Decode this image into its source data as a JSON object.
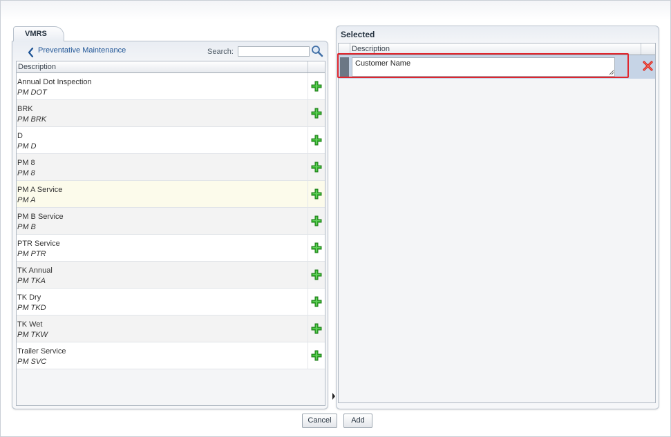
{
  "tab": {
    "label": "VMRS"
  },
  "left": {
    "back_label": "Preventative Maintenance",
    "search_label": "Search:",
    "search_value": "",
    "column_header": "Description",
    "rows": [
      {
        "title": "Annual Dot Inspection",
        "code": "PM DOT"
      },
      {
        "title": "BRK",
        "code": "PM BRK"
      },
      {
        "title": "D",
        "code": "PM D"
      },
      {
        "title": "PM 8",
        "code": "PM 8"
      },
      {
        "title": "PM A Service",
        "code": "PM A"
      },
      {
        "title": "PM B Service",
        "code": "PM B"
      },
      {
        "title": "PTR Service",
        "code": "PM PTR"
      },
      {
        "title": "TK Annual",
        "code": "PM TKA"
      },
      {
        "title": "TK Dry",
        "code": "PM TKD"
      },
      {
        "title": "TK Wet",
        "code": "PM TKW"
      },
      {
        "title": "Trailer Service",
        "code": "PM SVC"
      }
    ]
  },
  "right": {
    "title": "Selected",
    "column_header": "Description",
    "selected_value": "Customer Name"
  },
  "buttons": {
    "cancel": "Cancel",
    "add": "Add"
  },
  "colors": {
    "accent": "#1d5395",
    "highlight_border": "#e0262e",
    "add_icon": "#2fa82a",
    "delete_icon": "#d9261c"
  }
}
